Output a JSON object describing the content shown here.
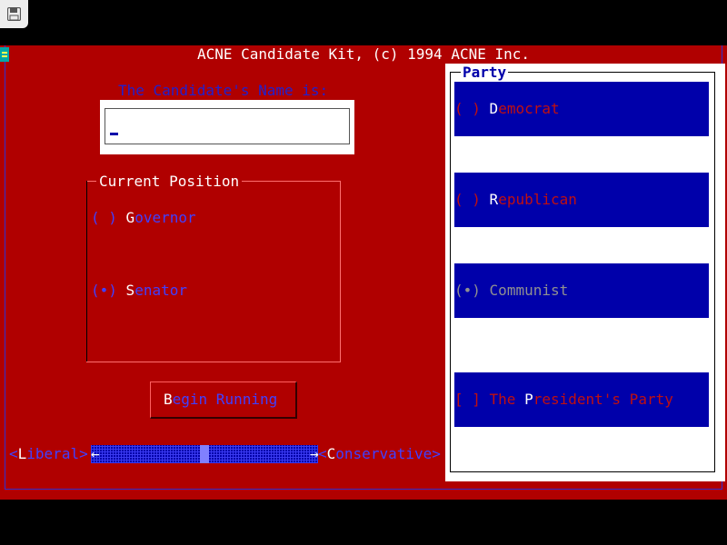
{
  "window_title": "ACNE Candidate Kit, (c) 1994 ACNE Inc.",
  "name_label": "The Candidate's Name is:",
  "name_value": "",
  "position_group": {
    "title": "Current Position",
    "options": [
      {
        "radio": "( )",
        "hotkey": "G",
        "rest": "overnor",
        "selected": false
      },
      {
        "radio": "(•)",
        "hotkey": "S",
        "rest": "enator",
        "selected": true
      }
    ]
  },
  "begin_button": {
    "hotkey": "B",
    "rest": "egin Running"
  },
  "slider": {
    "left_label_open": "<",
    "left_hotkey": "L",
    "left_rest": "iberal>",
    "right_label_open": "<",
    "right_hotkey": "C",
    "right_rest": "onservative>",
    "arrow_left": "←",
    "arrow_right": "→",
    "value_fraction": 0.5
  },
  "party_group": {
    "title": "Party",
    "options": [
      {
        "radio": "( )",
        "hotkey": "D",
        "rest": "emocrat",
        "state": "normal"
      },
      {
        "radio": "( )",
        "hotkey": "R",
        "rest": "epublican",
        "state": "normal"
      },
      {
        "radio": "(•)",
        "hotkey": "",
        "rest": "Communist",
        "state": "disabled"
      },
      {
        "radio": "[ ]",
        "pre": " The ",
        "hotkey": "P",
        "rest": "resident's Party",
        "state": "normal"
      }
    ]
  },
  "colors": {
    "desktop": "#b00000",
    "accent": "#0000aa",
    "highlight_text": "#ffffff",
    "disabled_text": "#909090"
  }
}
